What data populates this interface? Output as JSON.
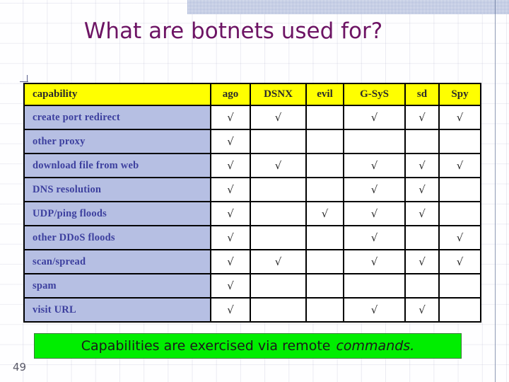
{
  "slide": {
    "title": "What are botnets used for?",
    "slide_number": "49"
  },
  "table": {
    "headers": [
      "capability",
      "ago",
      "DSNX",
      "evil",
      "G-SyS",
      "sd",
      "Spy"
    ],
    "check_glyph": "√",
    "rows": [
      {
        "capability": "create port redirect",
        "ago": "√",
        "DSNX": "√",
        "evil": "",
        "G-SyS": "√",
        "sd": "√",
        "Spy": "√"
      },
      {
        "capability": "other proxy",
        "ago": "√",
        "DSNX": "",
        "evil": "",
        "G-SyS": "",
        "sd": "",
        "Spy": ""
      },
      {
        "capability": "download file from web",
        "ago": "√",
        "DSNX": "√",
        "evil": "",
        "G-SyS": "√",
        "sd": "√",
        "Spy": "√"
      },
      {
        "capability": "DNS resolution",
        "ago": "√",
        "DSNX": "",
        "evil": "",
        "G-SyS": "√",
        "sd": "√",
        "Spy": ""
      },
      {
        "capability": "UDP/ping floods",
        "ago": "√",
        "DSNX": "",
        "evil": "√",
        "G-SyS": "√",
        "sd": "√",
        "Spy": ""
      },
      {
        "capability": "other DDoS floods",
        "ago": "√",
        "DSNX": "",
        "evil": "",
        "G-SyS": "√",
        "sd": "",
        "Spy": "√"
      },
      {
        "capability": "scan/spread",
        "ago": "√",
        "DSNX": "√",
        "evil": "",
        "G-SyS": "√",
        "sd": "√",
        "Spy": "√"
      },
      {
        "capability": "spam",
        "ago": "√",
        "DSNX": "",
        "evil": "",
        "G-SyS": "",
        "sd": "",
        "Spy": ""
      },
      {
        "capability": "visit URL",
        "ago": "√",
        "DSNX": "",
        "evil": "",
        "G-SyS": "√",
        "sd": "√",
        "Spy": ""
      }
    ]
  },
  "callout": {
    "text": "Capabilities are exercised via remote",
    "emphasis": "commands."
  },
  "colors": {
    "title": "#6d1464",
    "header_fill": "#ffff00",
    "row_label_fill": "#b6bfe3",
    "row_label_text": "#3c3f9e",
    "callout_fill": "#00ee00",
    "table_border": "#000000"
  }
}
